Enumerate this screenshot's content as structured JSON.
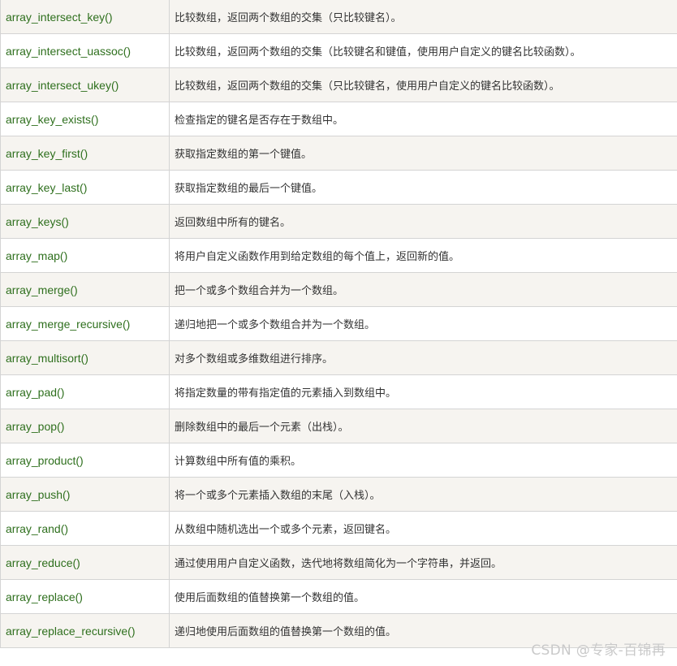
{
  "rows": [
    {
      "name": "array_intersect_key()",
      "desc": "比较数组，返回两个数组的交集（只比较键名）。"
    },
    {
      "name": "array_intersect_uassoc()",
      "desc": "比较数组，返回两个数组的交集（比较键名和键值，使用用户自定义的键名比较函数）。"
    },
    {
      "name": "array_intersect_ukey()",
      "desc": "比较数组，返回两个数组的交集（只比较键名，使用用户自定义的键名比较函数）。"
    },
    {
      "name": "array_key_exists()",
      "desc": "检查指定的键名是否存在于数组中。"
    },
    {
      "name": "array_key_first()",
      "desc": "获取指定数组的第一个键值。"
    },
    {
      "name": "array_key_last()",
      "desc": "获取指定数组的最后一个键值。"
    },
    {
      "name": "array_keys()",
      "desc": "返回数组中所有的键名。"
    },
    {
      "name": "array_map()",
      "desc": "将用户自定义函数作用到给定数组的每个值上，返回新的值。"
    },
    {
      "name": "array_merge()",
      "desc": "把一个或多个数组合并为一个数组。"
    },
    {
      "name": "array_merge_recursive()",
      "desc": "递归地把一个或多个数组合并为一个数组。"
    },
    {
      "name": "array_multisort()",
      "desc": "对多个数组或多维数组进行排序。"
    },
    {
      "name": "array_pad()",
      "desc": "将指定数量的带有指定值的元素插入到数组中。"
    },
    {
      "name": "array_pop()",
      "desc": "删除数组中的最后一个元素（出栈）。"
    },
    {
      "name": "array_product()",
      "desc": "计算数组中所有值的乘积。"
    },
    {
      "name": "array_push()",
      "desc": "将一个或多个元素插入数组的末尾（入栈）。"
    },
    {
      "name": "array_rand()",
      "desc": "从数组中随机选出一个或多个元素，返回键名。"
    },
    {
      "name": "array_reduce()",
      "desc": "通过使用用户自定义函数，迭代地将数组简化为一个字符串，并返回。"
    },
    {
      "name": "array_replace()",
      "desc": "使用后面数组的值替换第一个数组的值。"
    },
    {
      "name": "array_replace_recursive()",
      "desc": "递归地使用后面数组的值替换第一个数组的值。"
    }
  ],
  "watermark": "CSDN @专家-百锦再",
  "colors": {
    "link": "#2e6f1d",
    "row_alt_bg": "#f6f4f0",
    "border": "#d4d4d4",
    "text": "#333333"
  }
}
